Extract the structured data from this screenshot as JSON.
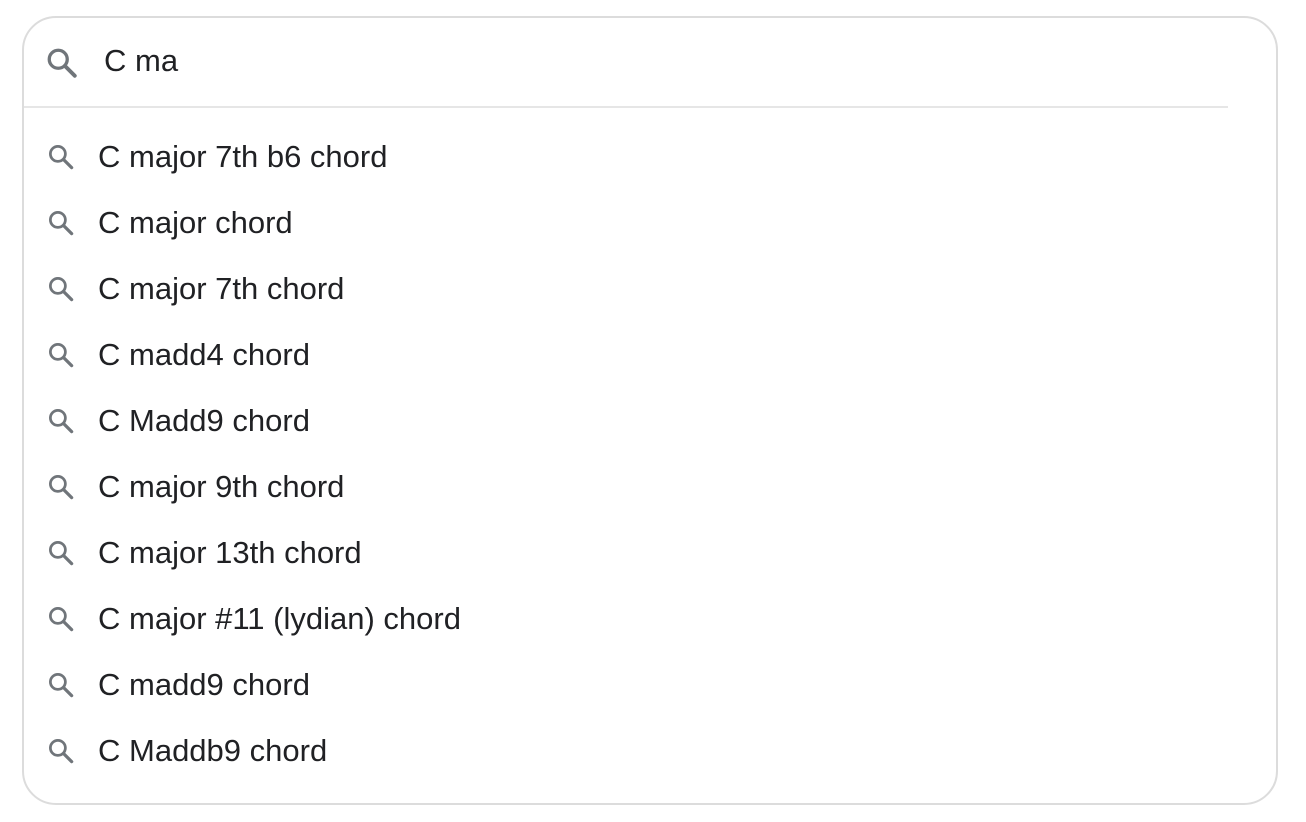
{
  "search": {
    "query": "C ma",
    "icon": "search-icon"
  },
  "suggestions": [
    {
      "label": "C major 7th b6 chord",
      "icon": "search-icon"
    },
    {
      "label": "C major chord",
      "icon": "search-icon"
    },
    {
      "label": "C major 7th chord",
      "icon": "search-icon"
    },
    {
      "label": "C madd4 chord",
      "icon": "search-icon"
    },
    {
      "label": "C Madd9 chord",
      "icon": "search-icon"
    },
    {
      "label": "C major 9th chord",
      "icon": "search-icon"
    },
    {
      "label": "C major 13th chord",
      "icon": "search-icon"
    },
    {
      "label": "C major #11 (lydian) chord",
      "icon": "search-icon"
    },
    {
      "label": "C madd9 chord",
      "icon": "search-icon"
    },
    {
      "label": "C Maddb9 chord",
      "icon": "search-icon"
    }
  ],
  "colors": {
    "text": "#202124",
    "icon": "#70757a",
    "border": "#dcdcdc",
    "divider": "#e6e6e6"
  }
}
